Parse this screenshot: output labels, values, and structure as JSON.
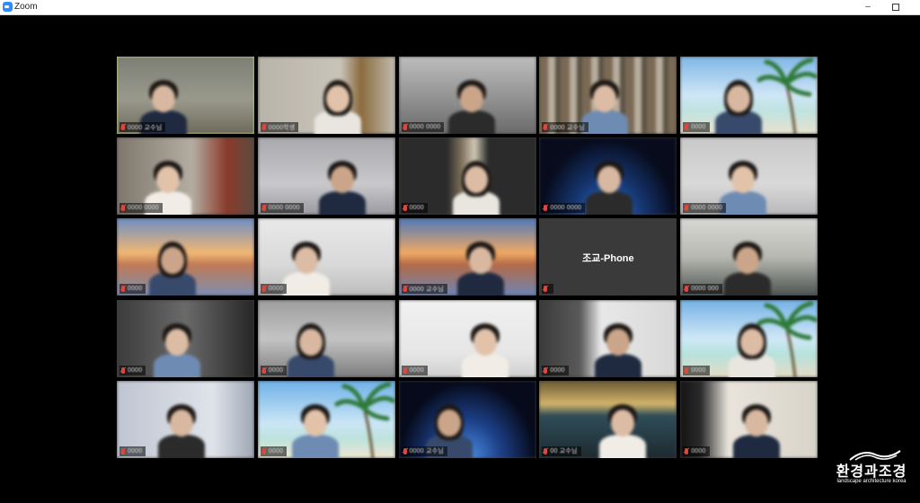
{
  "window": {
    "title": "Zoom",
    "minimize_glyph": "–",
    "app_icon": "zoom-camera-icon"
  },
  "gallery": {
    "participants": [
      {
        "name": "0000 교수님",
        "scene": "room-light",
        "active": true
      },
      {
        "name": "0000학생",
        "scene": "room-door"
      },
      {
        "name": "0000 0000",
        "scene": "room-grey"
      },
      {
        "name": "0000 교수님",
        "scene": "bookshelf"
      },
      {
        "name": "0000",
        "scene": "beach"
      },
      {
        "name": "0000 0000",
        "scene": "room-red"
      },
      {
        "name": "0000 0000",
        "scene": "room-white"
      },
      {
        "name": "0000",
        "scene": "dark-window"
      },
      {
        "name": "0000 0000",
        "scene": "earth"
      },
      {
        "name": "0000 0000",
        "scene": "room-white2"
      },
      {
        "name": "0000",
        "scene": "bridge-sunset"
      },
      {
        "name": "0000",
        "scene": "room-bright"
      },
      {
        "name": "0000 교수님",
        "scene": "bridge-sunset2"
      },
      {
        "name": "",
        "scene": "label-only",
        "label": "조교-Phone"
      },
      {
        "name": "0000 000",
        "scene": "room-office"
      },
      {
        "name": "0000",
        "scene": "room-dark"
      },
      {
        "name": "0000",
        "scene": "room-light2"
      },
      {
        "name": "0000",
        "scene": "room-white3"
      },
      {
        "name": "0000",
        "scene": "room-office2"
      },
      {
        "name": "0000",
        "scene": "beach2"
      },
      {
        "name": "0000",
        "scene": "room-white4"
      },
      {
        "name": "0000",
        "scene": "beach3"
      },
      {
        "name": "0000 교수님",
        "scene": "earth2"
      },
      {
        "name": "00 교수님",
        "scene": "window-night"
      },
      {
        "name": "0000",
        "scene": "room-side"
      }
    ]
  },
  "watermark": {
    "title": "환경과조경",
    "subtitle": "landscape architecture korea"
  },
  "colors": {
    "active_speaker_border": "#c3d36a",
    "muted_icon": "#e0463d",
    "background": "#000000"
  }
}
